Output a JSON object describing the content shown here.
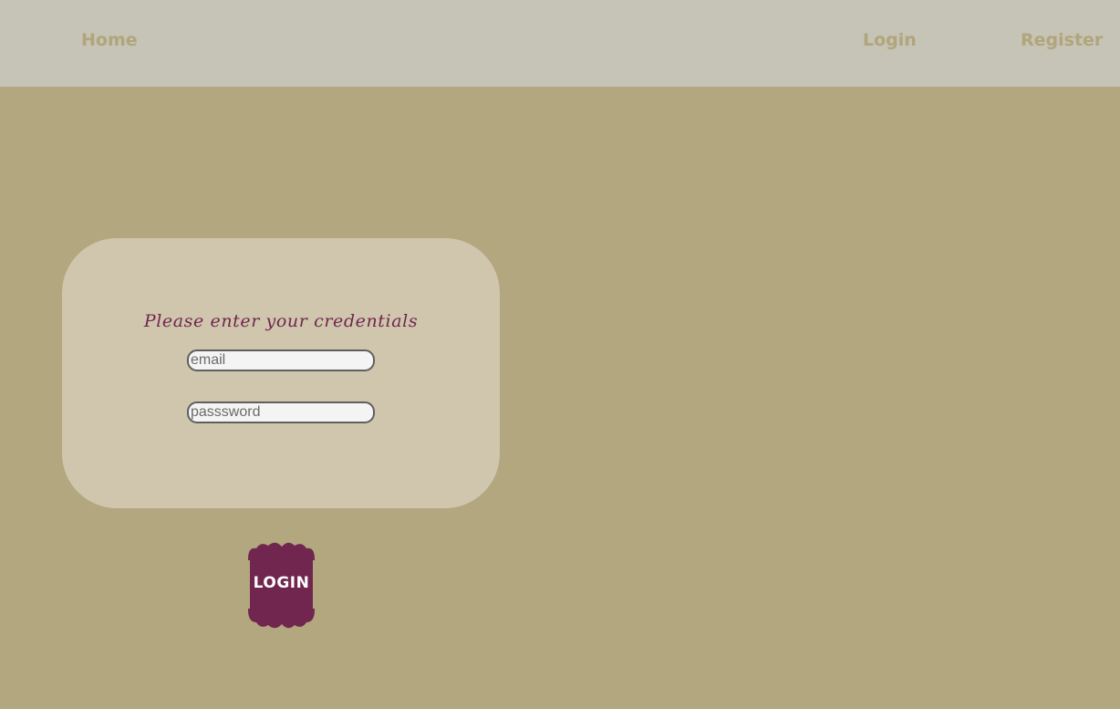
{
  "nav": {
    "home": "Home",
    "login": "Login",
    "register": "Register"
  },
  "login_form": {
    "title": "Please enter your credentials",
    "email_placeholder": "email",
    "password_placeholder": "passsword",
    "submit_label": "LOGIN"
  },
  "colors": {
    "page_background": "#b2a77e",
    "navbar_background": "#c6c3b7",
    "nav_text": "#b1a57a",
    "card_background": "#cfc6ad",
    "accent": "#71264f"
  }
}
